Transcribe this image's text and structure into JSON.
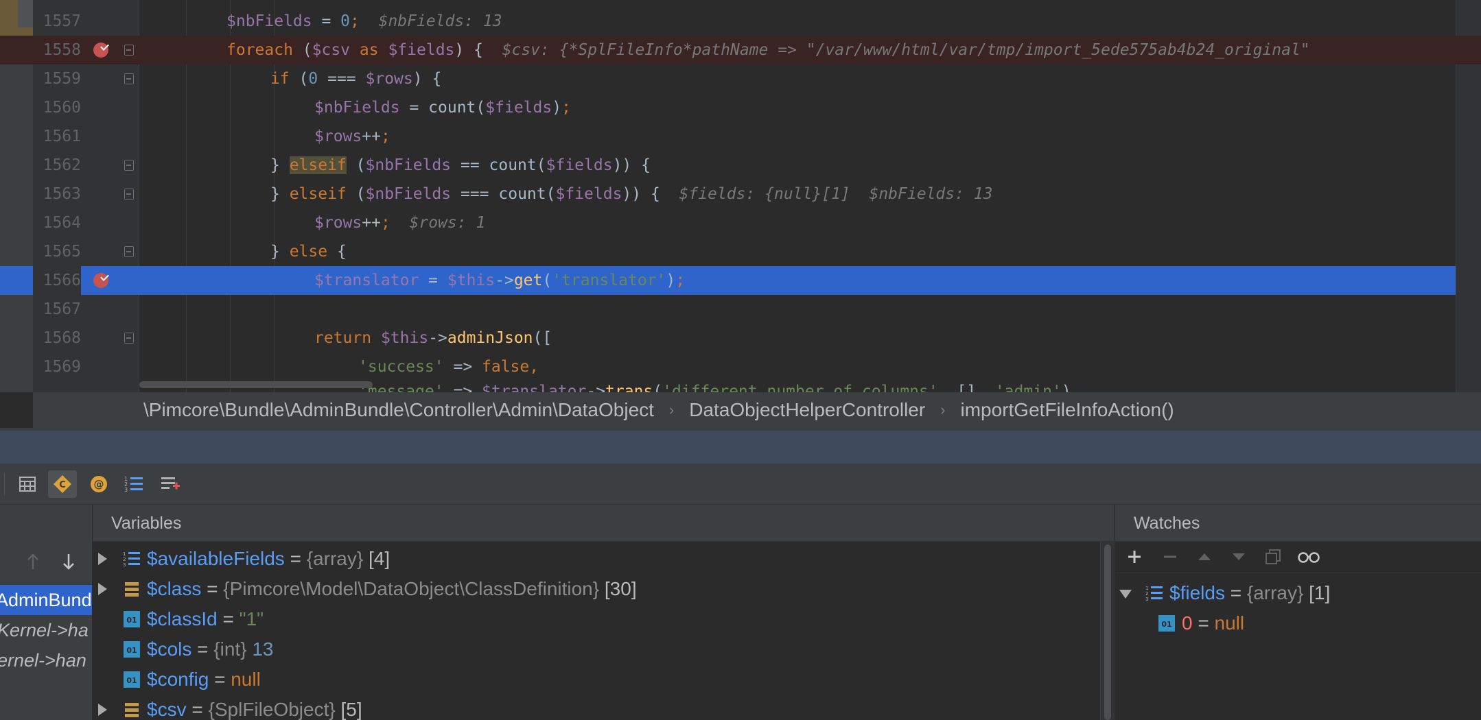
{
  "editor": {
    "lines": [
      {
        "num": "1557"
      },
      {
        "num": "1558"
      },
      {
        "num": "1559"
      },
      {
        "num": "1560"
      },
      {
        "num": "1561"
      },
      {
        "num": "1562"
      },
      {
        "num": "1563"
      },
      {
        "num": "1564"
      },
      {
        "num": "1565"
      },
      {
        "num": "1566"
      },
      {
        "num": "1567"
      },
      {
        "num": "1568"
      },
      {
        "num": "1569"
      }
    ],
    "hints": {
      "l1557": "$nbFields: 13",
      "l1558": "$csv: {*SplFileInfo*pathName => \"/var/www/html/var/tmp/import_5ede575ab4b24_original\"",
      "l1563_fields": "$fields: {null}[1]",
      "l1563_nb": "$nbFields: 13",
      "l1564": "$rows: 1"
    },
    "tokens": {
      "nbFields": "$nbFields",
      "csv": "$csv",
      "fields": "$fields",
      "rows": "$rows",
      "translator": "$translator",
      "this": "$this",
      "foreach": "foreach",
      "as": "as",
      "if": "if",
      "elseif": "elseif",
      "else": "else",
      "return": "return",
      "false": "false",
      "count": "count",
      "get": "get",
      "adminJson": "adminJson",
      "trans": "trans",
      "zero": "0",
      "str_translator": "'translator'",
      "str_success": "'success'",
      "str_message": "'message'",
      "str_diff": "'different number of columns'",
      "str_admin": "'admin'"
    }
  },
  "breadcrumb": {
    "namespace": "\\Pimcore\\Bundle\\AdminBundle\\Controller\\Admin\\DataObject",
    "class": "DataObjectHelperController",
    "method": "importGetFileInfoAction()",
    "separator": "›"
  },
  "toolbar": {
    "icons": [
      "calculator-icon",
      "class-constants-icon",
      "at-sign-icon",
      "numbered-list-icon",
      "add-watch-list-icon"
    ]
  },
  "frames": {
    "items": [
      "AdminBundle",
      "Kernel->ha",
      "ernel->han"
    ]
  },
  "variables": {
    "title": "Variables",
    "rows": [
      {
        "name": "$availableFields",
        "eq": "=",
        "type": "{array}",
        "value": "[4]"
      },
      {
        "name": "$class",
        "eq": "=",
        "type": "{Pimcore\\Model\\DataObject\\ClassDefinition}",
        "value": "[30]"
      },
      {
        "name": "$classId",
        "eq": "=",
        "type": "",
        "value": "\"1\""
      },
      {
        "name": "$cols",
        "eq": "=",
        "type": "{int}",
        "value": "13"
      },
      {
        "name": "$config",
        "eq": "=",
        "type": "",
        "value": "null"
      },
      {
        "name": "$csv",
        "eq": "=",
        "type": "{SplFileObject}",
        "value": "[5]"
      }
    ]
  },
  "watches": {
    "title": "Watches",
    "rows": [
      {
        "name": "$fields",
        "eq": "=",
        "type": "{array}",
        "value": "[1]"
      },
      {
        "name": "0",
        "eq": "=",
        "type": "",
        "value": "null"
      }
    ]
  },
  "colors": {
    "accent": "#2f65ca",
    "breakpoint": "#c75450",
    "variable": "#9876aa",
    "keyword": "#cc7832",
    "string": "#6a8759"
  }
}
